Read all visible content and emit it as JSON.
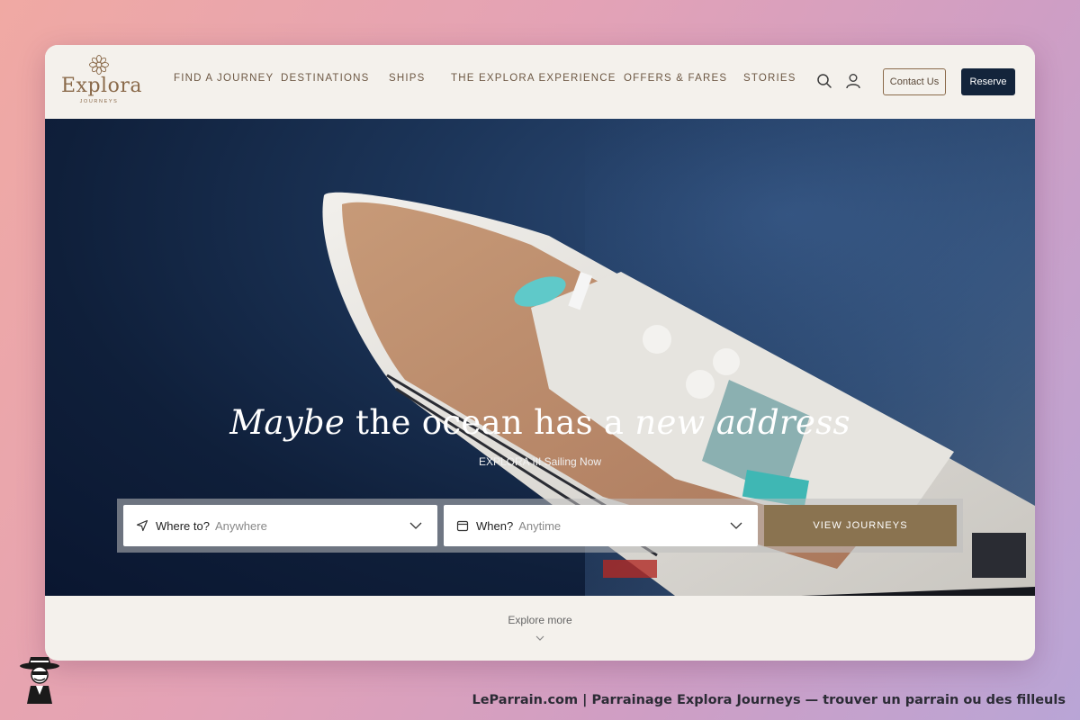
{
  "header": {
    "logo_text": "Explora",
    "logo_sub": "JOURNEYS",
    "nav": [
      "FIND A JOURNEY",
      "DESTINATIONS",
      "SHIPS",
      "THE EXPLORA EXPERIENCE",
      "OFFERS & FARES",
      "STORIES"
    ],
    "contact_label": "Contact Us",
    "reserve_label": "Reserve"
  },
  "hero": {
    "title_italic_1": "Maybe",
    "title_plain": " the ocean has a ",
    "title_italic_2": "new address",
    "subtitle": "EXPLORA III Sailing Now"
  },
  "search": {
    "where_label": "Where to?",
    "where_value": "Anywhere",
    "when_label": "When?",
    "when_value": "Anytime",
    "button_label": "VIEW JOURNEYS"
  },
  "explore_label": "Explore more",
  "caption": "LeParrain.com | Parrainage Explora Journeys — trouver un parrain ou des filleuls",
  "colors": {
    "brand_gold": "#8a6a4a",
    "reserve_navy": "#13243b",
    "view_button": "#8a7350"
  },
  "icons": [
    "flower-logo-icon",
    "search-icon",
    "user-icon",
    "navigation-arrow-icon",
    "calendar-icon",
    "chevron-down-icon"
  ]
}
